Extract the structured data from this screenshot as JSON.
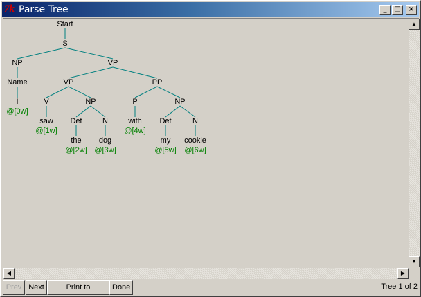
{
  "window": {
    "title": "Parse Tree",
    "icon_text": "7k",
    "minimize_glyph": "_",
    "maximize_glyph": "□",
    "close_glyph": "×"
  },
  "tree": {
    "nodes": [
      {
        "id": "start",
        "label": "Start"
      },
      {
        "id": "s",
        "label": "S"
      },
      {
        "id": "np1",
        "label": "NP"
      },
      {
        "id": "vp1",
        "label": "VP"
      },
      {
        "id": "name",
        "label": "Name"
      },
      {
        "id": "i",
        "label": "I"
      },
      {
        "id": "vp2",
        "label": "VP"
      },
      {
        "id": "pp",
        "label": "PP"
      },
      {
        "id": "v",
        "label": "V"
      },
      {
        "id": "np2",
        "label": "NP"
      },
      {
        "id": "p",
        "label": "P"
      },
      {
        "id": "np3",
        "label": "NP"
      },
      {
        "id": "saw",
        "label": "saw"
      },
      {
        "id": "det1",
        "label": "Det"
      },
      {
        "id": "n1",
        "label": "N"
      },
      {
        "id": "with",
        "label": "with"
      },
      {
        "id": "det2",
        "label": "Det"
      },
      {
        "id": "n2",
        "label": "N"
      },
      {
        "id": "the",
        "label": "the"
      },
      {
        "id": "dog",
        "label": "dog"
      },
      {
        "id": "my",
        "label": "my"
      },
      {
        "id": "cookie",
        "label": "cookie"
      }
    ],
    "leaves": [
      {
        "id": "l0",
        "label": "@[0w]"
      },
      {
        "id": "l1",
        "label": "@[1w]"
      },
      {
        "id": "l2",
        "label": "@[2w]"
      },
      {
        "id": "l3",
        "label": "@[3w]"
      },
      {
        "id": "l4",
        "label": "@[4w]"
      },
      {
        "id": "l5",
        "label": "@[5w]"
      },
      {
        "id": "l6",
        "label": "@[6w]"
      }
    ],
    "edge_color": "#008080",
    "leaf_color": "#008000"
  },
  "scroll": {
    "up_glyph": "▲",
    "down_glyph": "▼",
    "left_glyph": "◀",
    "right_glyph": "▶"
  },
  "buttons": {
    "prev": "Prev",
    "next": "Next",
    "print": "Print to Postscript",
    "done": "Done"
  },
  "status": "Tree 1 of 2"
}
